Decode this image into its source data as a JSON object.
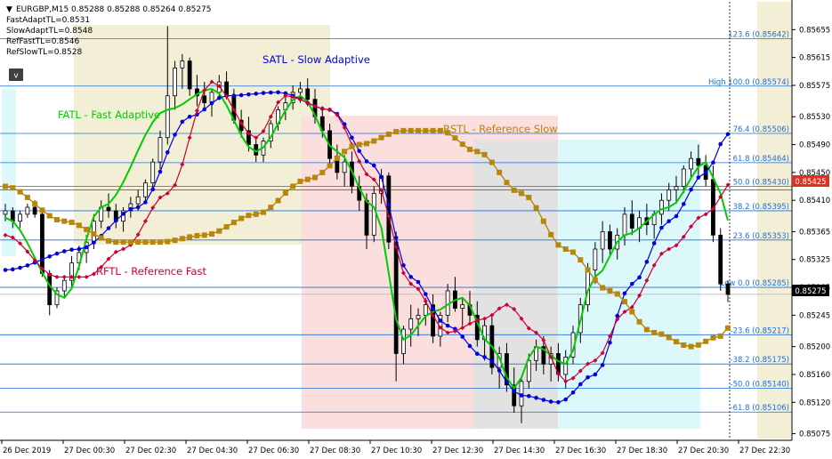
{
  "header": {
    "symbol_line": "EURGBP,M15  0.85288 0.85288 0.85264 0.85275",
    "indicators": [
      "FastAdaptTL=0.8531",
      "SlowAdaptTL=0.8548",
      "RefFastTL=0.8546",
      "RefSlowTL=0.8528"
    ],
    "collapse_button": "v"
  },
  "annotations": {
    "satl": "SATL - Slow Adaptive",
    "fatl": "FATL - Fast Adaptive",
    "rstl": "RSTL - Reference Slow",
    "rftl": "RFTL - Reference Fast"
  },
  "price_tags": {
    "red": "0.85425",
    "black": "0.85275"
  },
  "colors": {
    "fatl": "#00cc00",
    "satl": "#0000dd",
    "rftl": "#cc0033",
    "rstl": "#b8860b",
    "fib": "#1e6fd9",
    "zone_yellow": "#f3efd6",
    "zone_red": "#fbdede",
    "zone_gray": "#e2e2e2",
    "zone_cyan": "#dcf8fb",
    "bid_line": "#e07b39"
  },
  "chart_data": {
    "type": "candlestick",
    "symbol": "EURGBP",
    "timeframe": "M15",
    "ylim": [
      0.85068,
      0.85695
    ],
    "y_ticks": [
      0.85655,
      0.85615,
      0.85575,
      0.8553,
      0.8549,
      0.8545,
      0.8541,
      0.85365,
      0.85325,
      0.85285,
      0.85245,
      0.852,
      0.8516,
      0.8512,
      0.85075
    ],
    "x_ticks": [
      "26 Dec 2019",
      "27 Dec 00:30",
      "27 Dec 02:30",
      "27 Dec 04:30",
      "27 Dec 06:30",
      "27 Dec 08:30",
      "27 Dec 10:30",
      "27 Dec 12:30",
      "27 Dec 14:30",
      "27 Dec 16:30",
      "27 Dec 18:30",
      "27 Dec 20:30",
      "27 Dec 22:30"
    ],
    "fib_levels": [
      {
        "label": "123.6 (0.85642)",
        "value": 0.85642
      },
      {
        "label": "High 100.0 (0.85574)",
        "value": 0.85574
      },
      {
        "label": "76.4 (0.85506)",
        "value": 0.85506
      },
      {
        "label": "61.8 (0.85464)",
        "value": 0.85464
      },
      {
        "label": "50.0 (0.85430)",
        "value": 0.8543
      },
      {
        "label": "38.2 (0.85395)",
        "value": 0.85395
      },
      {
        "label": "23.6 (0.85353)",
        "value": 0.85353
      },
      {
        "label": "Low 0.0 (0.85285)",
        "value": 0.85285
      },
      {
        "label": "-23.6 (0.85217)",
        "value": 0.85217
      },
      {
        "label": "-38.2 (0.85175)",
        "value": 0.85175
      },
      {
        "label": "-50.0 (0.85140)",
        "value": 0.8514
      },
      {
        "label": "-61.8 (0.85106)",
        "value": 0.85106
      }
    ],
    "bid": 0.85275,
    "red_level": 0.85425,
    "candles": [
      [
        0.8539,
        0.85405,
        0.8538,
        0.85395
      ],
      [
        0.85395,
        0.854,
        0.8537,
        0.8538
      ],
      [
        0.8538,
        0.85395,
        0.8537,
        0.8539
      ],
      [
        0.8539,
        0.85405,
        0.85385,
        0.854
      ],
      [
        0.854,
        0.8541,
        0.85385,
        0.8539
      ],
      [
        0.8539,
        0.85395,
        0.853,
        0.85305
      ],
      [
        0.85305,
        0.8531,
        0.85245,
        0.8526
      ],
      [
        0.8526,
        0.85285,
        0.85255,
        0.8528
      ],
      [
        0.8528,
        0.853,
        0.8527,
        0.85295
      ],
      [
        0.85295,
        0.8533,
        0.85285,
        0.8532
      ],
      [
        0.8532,
        0.85345,
        0.8531,
        0.85335
      ],
      [
        0.85335,
        0.8536,
        0.8532,
        0.8535
      ],
      [
        0.8535,
        0.8539,
        0.8534,
        0.8538
      ],
      [
        0.8538,
        0.8541,
        0.8537,
        0.854
      ],
      [
        0.854,
        0.8542,
        0.85385,
        0.85395
      ],
      [
        0.85395,
        0.85405,
        0.8537,
        0.8538
      ],
      [
        0.8538,
        0.854,
        0.85365,
        0.85395
      ],
      [
        0.85395,
        0.85415,
        0.85385,
        0.85405
      ],
      [
        0.85405,
        0.85425,
        0.85395,
        0.85415
      ],
      [
        0.85415,
        0.8544,
        0.85405,
        0.85435
      ],
      [
        0.85435,
        0.8547,
        0.85425,
        0.85465
      ],
      [
        0.85465,
        0.8551,
        0.85455,
        0.855
      ],
      [
        0.855,
        0.8566,
        0.8549,
        0.8556
      ],
      [
        0.8556,
        0.8561,
        0.8554,
        0.856
      ],
      [
        0.856,
        0.8562,
        0.8557,
        0.8561
      ],
      [
        0.8561,
        0.85615,
        0.8556,
        0.8557
      ],
      [
        0.8557,
        0.8559,
        0.85545,
        0.8556
      ],
      [
        0.8556,
        0.8558,
        0.8554,
        0.8555
      ],
      [
        0.8555,
        0.8557,
        0.8553,
        0.85565
      ],
      [
        0.85565,
        0.8559,
        0.85555,
        0.8558
      ],
      [
        0.8558,
        0.85595,
        0.85555,
        0.8556
      ],
      [
        0.8556,
        0.8557,
        0.8552,
        0.85525
      ],
      [
        0.85525,
        0.8554,
        0.855,
        0.8551
      ],
      [
        0.8551,
        0.8553,
        0.8548,
        0.8549
      ],
      [
        0.8549,
        0.855,
        0.85465,
        0.85475
      ],
      [
        0.85475,
        0.855,
        0.85465,
        0.85495
      ],
      [
        0.85495,
        0.85525,
        0.85485,
        0.8552
      ],
      [
        0.8552,
        0.85545,
        0.8551,
        0.8554
      ],
      [
        0.8554,
        0.8556,
        0.85525,
        0.8555
      ],
      [
        0.8555,
        0.85575,
        0.8554,
        0.85565
      ],
      [
        0.85565,
        0.8558,
        0.8555,
        0.8557
      ],
      [
        0.8557,
        0.85585,
        0.85545,
        0.85555
      ],
      [
        0.85555,
        0.8557,
        0.8552,
        0.8553
      ],
      [
        0.8553,
        0.85545,
        0.855,
        0.8551
      ],
      [
        0.8551,
        0.8552,
        0.8546,
        0.8547
      ],
      [
        0.8547,
        0.8549,
        0.8544,
        0.8545
      ],
      [
        0.8545,
        0.85475,
        0.8543,
        0.85465
      ],
      [
        0.85465,
        0.8548,
        0.8542,
        0.8543
      ],
      [
        0.8543,
        0.85445,
        0.85395,
        0.8541
      ],
      [
        0.8541,
        0.8542,
        0.8534,
        0.8536
      ],
      [
        0.8536,
        0.8543,
        0.8535,
        0.8542
      ],
      [
        0.8542,
        0.85455,
        0.85405,
        0.85445
      ],
      [
        0.85445,
        0.8545,
        0.8534,
        0.8535
      ],
      [
        0.8535,
        0.85365,
        0.8515,
        0.8519
      ],
      [
        0.8519,
        0.8523,
        0.85175,
        0.85225
      ],
      [
        0.85225,
        0.8526,
        0.852,
        0.8524
      ],
      [
        0.8524,
        0.85255,
        0.85215,
        0.85245
      ],
      [
        0.85245,
        0.8527,
        0.8523,
        0.8526
      ],
      [
        0.8526,
        0.85275,
        0.85205,
        0.85215
      ],
      [
        0.85215,
        0.8525,
        0.852,
        0.85245
      ],
      [
        0.85245,
        0.8529,
        0.85235,
        0.8528
      ],
      [
        0.8528,
        0.853,
        0.8525,
        0.85255
      ],
      [
        0.85255,
        0.8527,
        0.8523,
        0.8526
      ],
      [
        0.8526,
        0.8528,
        0.85235,
        0.85245
      ],
      [
        0.85245,
        0.85265,
        0.852,
        0.8521
      ],
      [
        0.8521,
        0.8524,
        0.8518,
        0.8523
      ],
      [
        0.8523,
        0.85245,
        0.8516,
        0.8517
      ],
      [
        0.8517,
        0.852,
        0.8514,
        0.8519
      ],
      [
        0.8519,
        0.85205,
        0.85135,
        0.85145
      ],
      [
        0.85145,
        0.8517,
        0.85105,
        0.85115
      ],
      [
        0.85115,
        0.85155,
        0.8509,
        0.8515
      ],
      [
        0.8515,
        0.8519,
        0.8514,
        0.8518
      ],
      [
        0.8518,
        0.8521,
        0.85165,
        0.852
      ],
      [
        0.852,
        0.85215,
        0.8516,
        0.85175
      ],
      [
        0.85175,
        0.852,
        0.8515,
        0.8519
      ],
      [
        0.8519,
        0.85205,
        0.8515,
        0.8516
      ],
      [
        0.8516,
        0.85195,
        0.8514,
        0.85185
      ],
      [
        0.85185,
        0.8523,
        0.85175,
        0.8522
      ],
      [
        0.8522,
        0.8527,
        0.85205,
        0.8526
      ],
      [
        0.8526,
        0.8532,
        0.8525,
        0.8531
      ],
      [
        0.8531,
        0.8535,
        0.8529,
        0.8534
      ],
      [
        0.8534,
        0.8538,
        0.8532,
        0.85365
      ],
      [
        0.85365,
        0.85375,
        0.8533,
        0.8534
      ],
      [
        0.8534,
        0.8537,
        0.85325,
        0.8536
      ],
      [
        0.8536,
        0.854,
        0.85345,
        0.8539
      ],
      [
        0.8539,
        0.8541,
        0.8536,
        0.8537
      ],
      [
        0.8537,
        0.85395,
        0.8535,
        0.85385
      ],
      [
        0.85385,
        0.85405,
        0.8536,
        0.85375
      ],
      [
        0.85375,
        0.85395,
        0.85355,
        0.8539
      ],
      [
        0.8539,
        0.8542,
        0.85375,
        0.8541
      ],
      [
        0.8541,
        0.85435,
        0.85395,
        0.85425
      ],
      [
        0.85425,
        0.85445,
        0.85405,
        0.8543
      ],
      [
        0.8543,
        0.8546,
        0.8542,
        0.85455
      ],
      [
        0.85455,
        0.8548,
        0.8544,
        0.8547
      ],
      [
        0.8547,
        0.8549,
        0.85445,
        0.8546
      ],
      [
        0.8546,
        0.85475,
        0.8543,
        0.8544
      ],
      [
        0.8544,
        0.8546,
        0.8535,
        0.8536
      ],
      [
        0.8536,
        0.8537,
        0.8528,
        0.8529
      ],
      [
        0.8529,
        0.85295,
        0.85264,
        0.85275
      ]
    ],
    "series": [
      {
        "name": "FATL - Fast Adaptive",
        "points": [
          [
            0,
            0.85385
          ],
          [
            8,
            0.8527
          ],
          [
            13,
            0.854
          ],
          [
            22,
            0.8554
          ],
          [
            28,
            0.8557
          ],
          [
            34,
            0.8548
          ],
          [
            40,
            0.8556
          ],
          [
            45,
            0.8548
          ],
          [
            50,
            0.854
          ],
          [
            54,
            0.8521
          ],
          [
            58,
            0.8525
          ],
          [
            62,
            0.8527
          ],
          [
            66,
            0.852
          ],
          [
            69,
            0.8514
          ],
          [
            72,
            0.852
          ],
          [
            76,
            0.85175
          ],
          [
            80,
            0.853
          ],
          [
            84,
            0.8536
          ],
          [
            90,
            0.854
          ],
          [
            95,
            0.85465
          ],
          [
            97,
            0.8542
          ],
          [
            100,
            0.8527
          ]
        ]
      },
      {
        "name": "SATL - Slow Adaptive",
        "points": [
          [
            0,
            0.8531
          ],
          [
            10,
            0.8534
          ],
          [
            18,
            0.854
          ],
          [
            25,
            0.8553
          ],
          [
            30,
            0.8556
          ],
          [
            37,
            0.85565
          ],
          [
            44,
            0.8554
          ],
          [
            50,
            0.8546
          ],
          [
            55,
            0.853
          ],
          [
            60,
            0.8523
          ],
          [
            65,
            0.85185
          ],
          [
            70,
            0.8513
          ],
          [
            75,
            0.8512
          ],
          [
            80,
            0.8516
          ],
          [
            85,
            0.8529
          ],
          [
            90,
            0.8538
          ],
          [
            95,
            0.8545
          ],
          [
            98,
            0.85505
          ],
          [
            100,
            0.8547
          ]
        ]
      },
      {
        "name": "RFTL - Reference Fast",
        "points": [
          [
            0,
            0.8536
          ],
          [
            7,
            0.853
          ],
          [
            11,
            0.853
          ],
          [
            16,
            0.8534
          ],
          [
            22,
            0.8542
          ],
          [
            28,
            0.8558
          ],
          [
            34,
            0.855
          ],
          [
            38,
            0.8556
          ],
          [
            44,
            0.8554
          ],
          [
            50,
            0.8544
          ],
          [
            55,
            0.8529
          ],
          [
            60,
            0.8522
          ],
          [
            65,
            0.8524
          ],
          [
            68,
            0.8526
          ],
          [
            72,
            0.8522
          ],
          [
            76,
            0.8515
          ],
          [
            80,
            0.8518
          ],
          [
            84,
            0.8525
          ],
          [
            90,
            0.8534
          ],
          [
            95,
            0.8539
          ],
          [
            99,
            0.8544
          ]
        ]
      },
      {
        "name": "RSTL - Reference Slow",
        "points": [
          [
            0,
            0.8543
          ],
          [
            8,
            0.8538
          ],
          [
            15,
            0.8535
          ],
          [
            21,
            0.8535
          ],
          [
            27,
            0.8536
          ],
          [
            34,
            0.8539
          ],
          [
            41,
            0.8544
          ],
          [
            48,
            0.8549
          ],
          [
            54,
            0.8551
          ],
          [
            59,
            0.8551
          ],
          [
            64,
            0.8548
          ],
          [
            70,
            0.8542
          ],
          [
            76,
            0.8534
          ],
          [
            82,
            0.8528
          ],
          [
            88,
            0.8522
          ],
          [
            93,
            0.852
          ],
          [
            97,
            0.85215
          ],
          [
            100,
            0.8526
          ]
        ]
      }
    ]
  }
}
